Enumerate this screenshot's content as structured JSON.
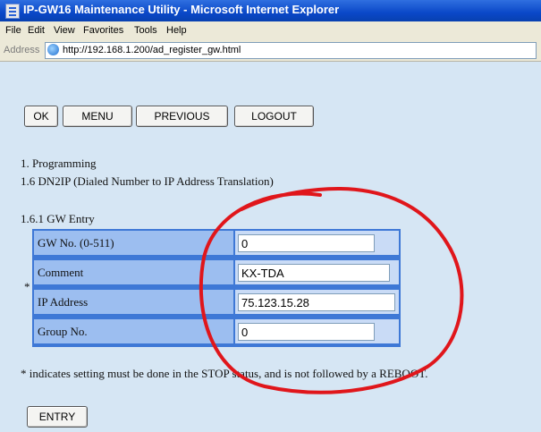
{
  "window": {
    "title": "IP-GW16 Maintenance Utility - Microsoft Internet Explorer",
    "icon": "ie-page-icon"
  },
  "menubar": {
    "items": [
      "File",
      "Edit",
      "View",
      "Favorites",
      "Tools",
      "Help"
    ]
  },
  "addressbar": {
    "label": "Address",
    "url": "http://192.168.1.200/ad_register_gw.html"
  },
  "buttons": {
    "ok": "OK",
    "menu": "MENU",
    "previous": "PREVIOUS",
    "logout": "LOGOUT",
    "entry": "ENTRY"
  },
  "breadcrumb": {
    "line1": "1. Programming",
    "line2": "1.6 DN2IP (Dialed Number to IP Address Translation)"
  },
  "section": {
    "title": "1.6.1 GW Entry",
    "required_marker": "*"
  },
  "form": {
    "rows": [
      {
        "label": "GW No. (0-511)",
        "value": "0"
      },
      {
        "label": "Comment",
        "value": "KX-TDA"
      },
      {
        "label": "IP Address",
        "value": "75.123.15.28"
      },
      {
        "label": "Group No.",
        "value": "0"
      }
    ]
  },
  "note": "* indicates setting must be done in the STOP status, and is not followed by a REBOOT.",
  "colors": {
    "annotation": "#e0161b",
    "table_header": "#3e78d6",
    "label_cell": "#9cbef0"
  }
}
